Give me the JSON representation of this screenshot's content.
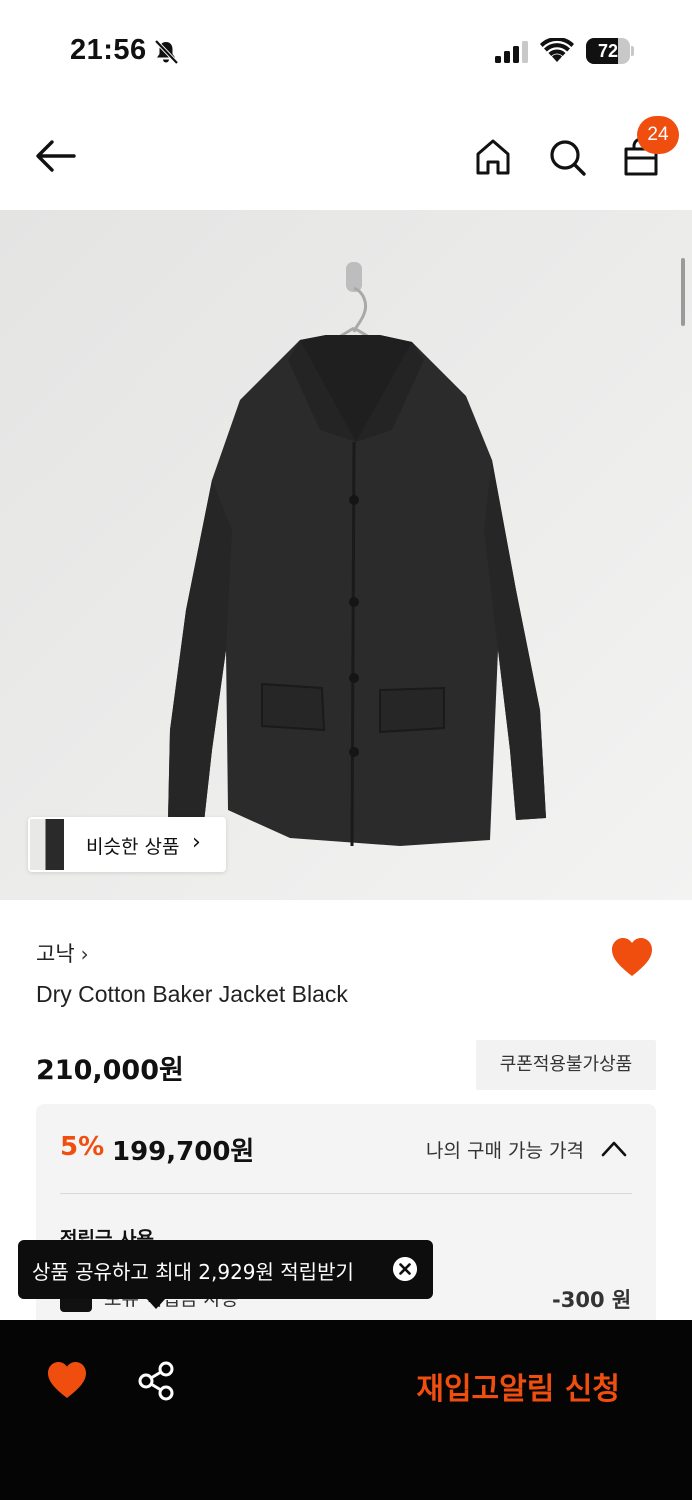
{
  "status_bar": {
    "time": "21:56",
    "battery_level": "72",
    "battery_fraction": 0.72,
    "icons": [
      "bell-slash-icon",
      "signal-icon",
      "wifi-icon",
      "battery-icon"
    ]
  },
  "nav": {
    "icons": [
      "arrow-left-icon",
      "home-icon",
      "search-icon",
      "shopping-bag-icon"
    ],
    "cart_count": "24"
  },
  "product_image": {
    "description_icon": "product-photo-jacket",
    "similar_label": "비슷한 상품",
    "similar_chevron": "›"
  },
  "product": {
    "brand": "고낙",
    "brand_chevron": "›",
    "name": "Dry Cotton Baker Jacket Black",
    "price": "210,000원",
    "coupon_badge": "쿠폰적용불가상품"
  },
  "discount": {
    "rate": "5%",
    "price": "199,700원",
    "toggle_label": "나의 구매 가능 가격",
    "points_label": "적립금 사용",
    "points_option": "보유 적립금 사용",
    "points_value": "-300 원"
  },
  "tooltip": {
    "text": "상품 공유하고 최대 2,929원 적립받기"
  },
  "bottom_bar": {
    "restock_label": "재입고알림 신청"
  },
  "colors": {
    "accent": "#f04e0f",
    "bottom_bar": "#050505",
    "panel": "#f4f4f4"
  }
}
